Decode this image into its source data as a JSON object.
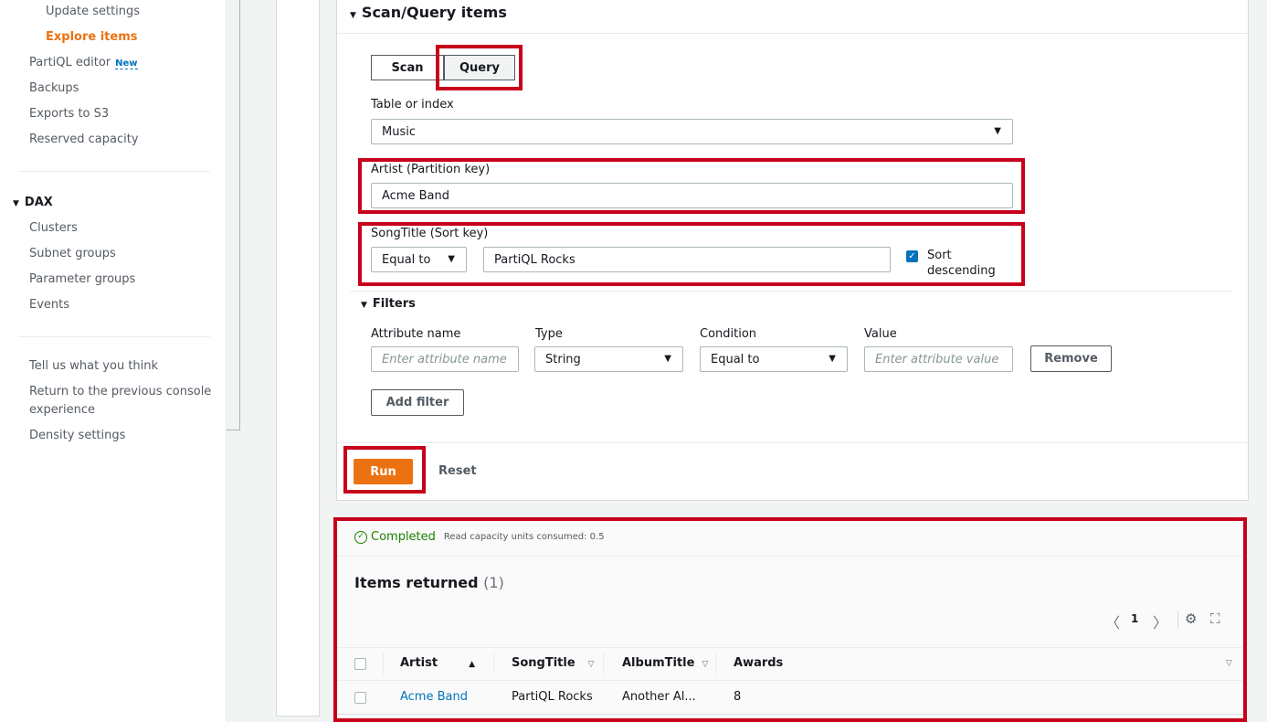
{
  "sidebar": {
    "items_top": [
      {
        "label": "Update settings",
        "sub": true,
        "active": false
      },
      {
        "label": "Explore items",
        "sub": true,
        "active": true
      },
      {
        "label": "PartiQL editor",
        "badge": "New"
      },
      {
        "label": "Backups"
      },
      {
        "label": "Exports to S3"
      },
      {
        "label": "Reserved capacity"
      }
    ],
    "dax_section": "DAX",
    "dax_items": [
      "Clusters",
      "Subnet groups",
      "Parameter groups",
      "Events"
    ],
    "footer_items": [
      "Tell us what you think",
      "Return to the previous console",
      "experience",
      "Density settings"
    ]
  },
  "panel": {
    "title": "Scan/Query items",
    "mode": {
      "scan_label": "Scan",
      "query_label": "Query",
      "selected": "Query"
    },
    "table_label": "Table or index",
    "table_value": "Music",
    "partition_label": "Artist (Partition key)",
    "partition_value": "Acme Band",
    "sort_label": "SongTitle (Sort key)",
    "sort_condition": "Equal to",
    "sort_value": "PartiQL Rocks",
    "sort_desc_label": "Sort descending",
    "sort_desc_checked": true,
    "filters": {
      "title": "Filters",
      "col_attr": "Attribute name",
      "col_type": "Type",
      "col_condition": "Condition",
      "col_value": "Value",
      "attr_placeholder": "Enter attribute name",
      "type_value": "String",
      "condition_value": "Equal to",
      "value_placeholder": "Enter attribute value",
      "remove_label": "Remove",
      "add_label": "Add filter"
    },
    "run_label": "Run",
    "reset_label": "Reset"
  },
  "results": {
    "status": "Completed",
    "rcu": "Read capacity units consumed: 0.5",
    "title": "Items returned",
    "count": "(1)",
    "page": "1",
    "columns": [
      "Artist",
      "SongTitle",
      "AlbumTitle",
      "Awards"
    ],
    "rows": [
      {
        "Artist": "Acme Band",
        "SongTitle": "PartiQL Rocks",
        "AlbumTitle": "Another Al...",
        "Awards": "8"
      }
    ]
  },
  "colors": {
    "accent": "#ec7211",
    "link": "#0073bb",
    "highlight": "#c7001b",
    "success": "#1d8102"
  },
  "icons": [
    "triangle-down-icon",
    "check-icon",
    "check-circle-icon",
    "chevron-left-icon",
    "chevron-right-icon",
    "gear-icon",
    "fullscreen-icon",
    "sort-up-icon",
    "sort-down-icon"
  ]
}
